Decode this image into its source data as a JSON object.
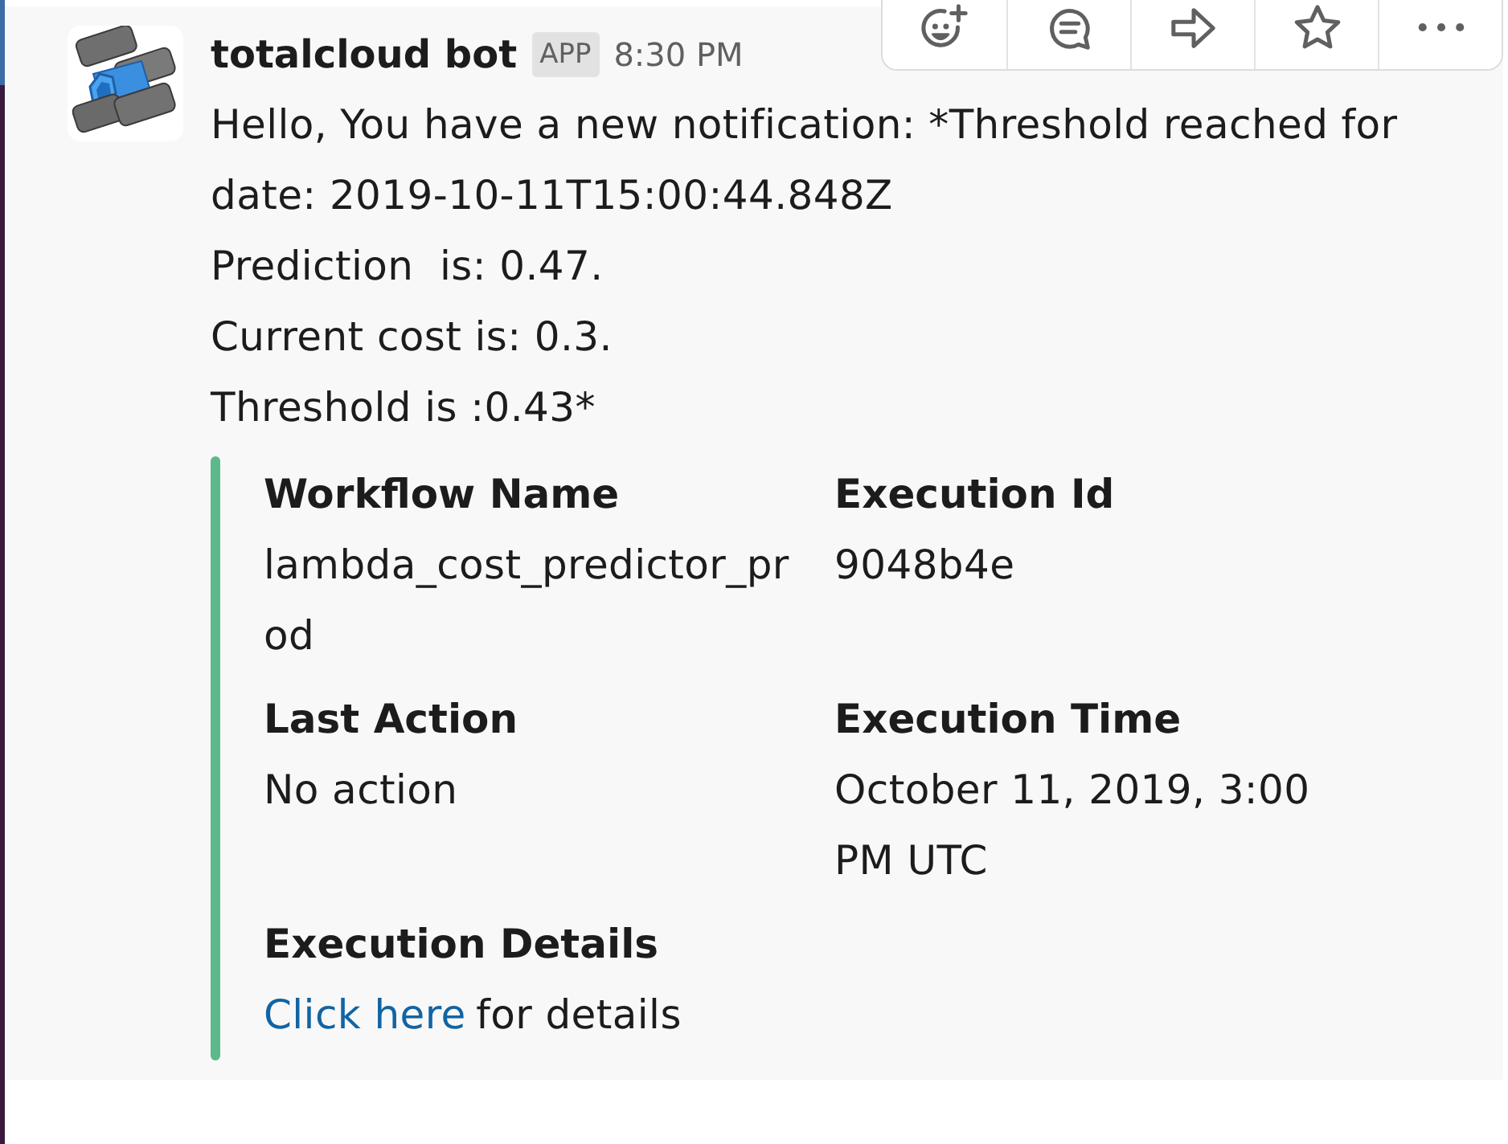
{
  "message": {
    "sender": "totalcloud bot",
    "badge": "APP",
    "time": "8:30 PM",
    "lines": [
      "Hello, You have a new notification: *Threshold reached for date: 2019-10-11T15:00:44.848Z",
      "Prediction  is: 0.47.",
      "Current cost is: 0.3.",
      "Threshold is :0.43*"
    ]
  },
  "attachment": {
    "fields": [
      {
        "title": "Workflow Name",
        "value": "lambda_cost_predictor_prod"
      },
      {
        "title": "Execution Id",
        "value": "9048b4e"
      },
      {
        "title": "Last Action",
        "value": "No action"
      },
      {
        "title": "Execution Time",
        "value": "October 11, 2019, 3:00 PM UTC"
      },
      {
        "title": "Execution Details",
        "link": "Click here",
        "value": "for details"
      }
    ]
  }
}
